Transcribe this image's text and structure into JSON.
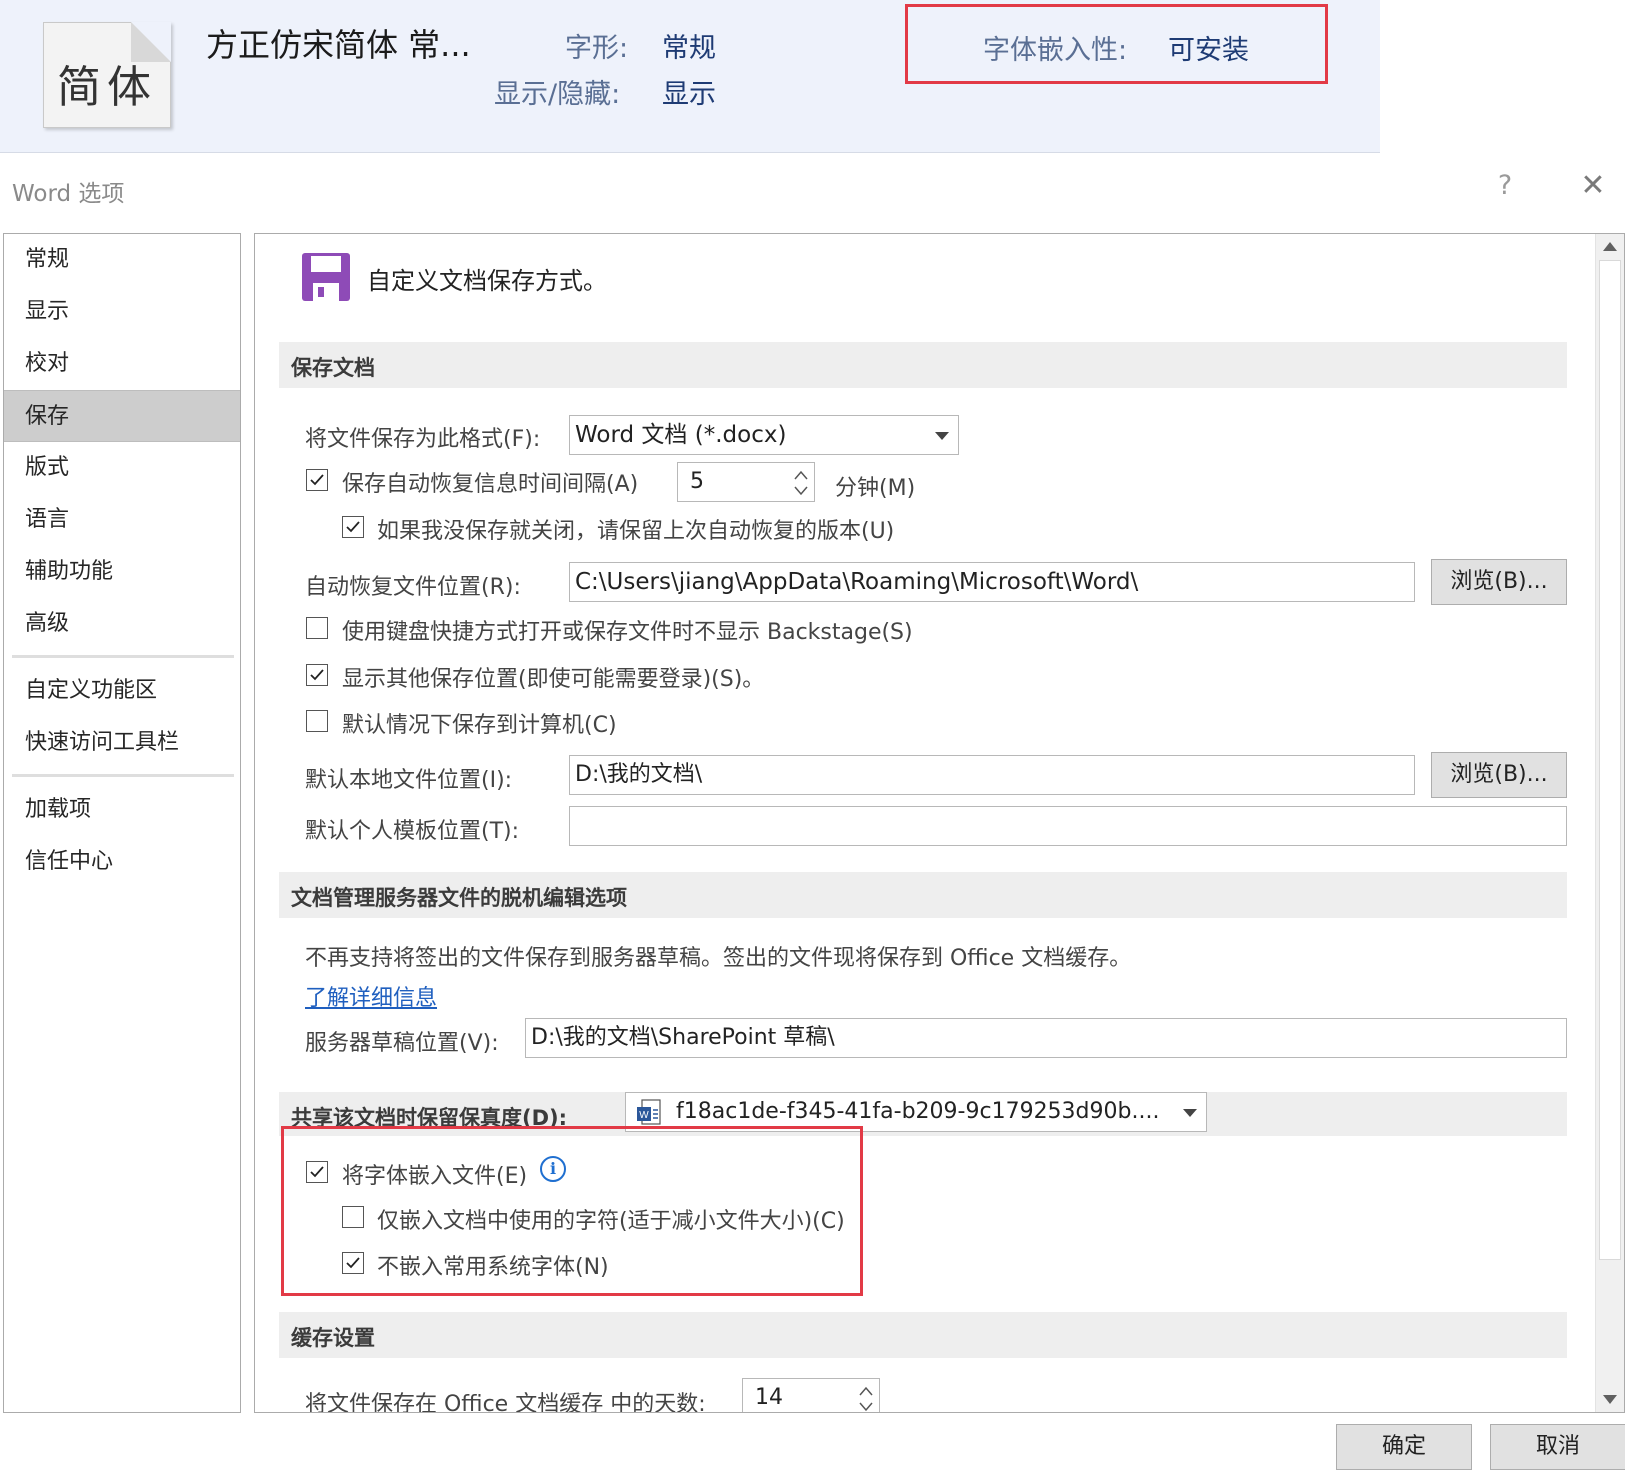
{
  "font_info": {
    "thumbnail": "简体",
    "name": "方正仿宋简体 常...",
    "style_label": "字形:",
    "style_value": "常规",
    "visibility_label": "显示/隐藏:",
    "visibility_value": "显示",
    "embed_label": "字体嵌入性:",
    "embed_value": "可安装"
  },
  "dialog": {
    "title": "Word 选项",
    "help": "?",
    "close": "✕",
    "ok": "确定",
    "cancel": "取消"
  },
  "nav": {
    "items": [
      {
        "label": "常规"
      },
      {
        "label": "显示"
      },
      {
        "label": "校对"
      },
      {
        "label": "保存",
        "selected": true
      },
      {
        "label": "版式"
      },
      {
        "label": "语言"
      },
      {
        "label": "辅助功能"
      },
      {
        "label": "高级"
      },
      {
        "label": "自定义功能区"
      },
      {
        "label": "快速访问工具栏"
      },
      {
        "label": "加载项"
      },
      {
        "label": "信任中心"
      }
    ]
  },
  "page": {
    "icon": "floppy-disk-icon",
    "heading": "自定义文档保存方式。"
  },
  "save_documents": {
    "header": "保存文档",
    "format_label": "将文件保存为此格式(F):",
    "format_value": "Word 文档 (*.docx)",
    "autorecover_label": "保存自动恢复信息时间间隔(A)",
    "autorecover_checked": true,
    "autorecover_minutes": "5",
    "minutes_label": "分钟(M)",
    "keep_last_label": "如果我没保存就关闭，请保留上次自动恢复的版本(U)",
    "keep_last_checked": true,
    "autorecover_location_label": "自动恢复文件位置(R):",
    "autorecover_location_value": "C:\\Users\\jiang\\AppData\\Roaming\\Microsoft\\Word\\",
    "browse_label": "浏览(B)...",
    "no_backstage_label": "使用键盘快捷方式打开或保存文件时不显示 Backstage(S)",
    "no_backstage_checked": false,
    "show_additional_label": "显示其他保存位置(即使可能需要登录)(S)。",
    "show_additional_checked": true,
    "save_to_computer_label": "默认情况下保存到计算机(C)",
    "save_to_computer_checked": false,
    "local_location_label": "默认本地文件位置(I):",
    "local_location_value": "D:\\我的文档\\",
    "browse2_label": "浏览(B)...",
    "template_location_label": "默认个人模板位置(T):",
    "template_location_value": ""
  },
  "offline_editing": {
    "header": "文档管理服务器文件的脱机编辑选项",
    "notice": "不再支持将签出的文件保存到服务器草稿。签出的文件现将保存到 Office 文档缓存。",
    "learn_more": "了解详细信息",
    "drafts_label": "服务器草稿位置(V):",
    "drafts_value": "D:\\我的文档\\SharePoint 草稿\\"
  },
  "fidelity": {
    "header": "共享该文档时保留保真度(D):",
    "document_value": "f18ac1de-f345-41fa-b209-9c179253d90b....",
    "embed_fonts_label": "将字体嵌入文件(E)",
    "embed_fonts_checked": true,
    "info_icon": "i",
    "embed_used_only_label": "仅嵌入文档中使用的字符(适于减小文件大小)(C)",
    "embed_used_only_checked": false,
    "no_common_fonts_label": "不嵌入常用系统字体(N)",
    "no_common_fonts_checked": true
  },
  "cache": {
    "header": "缓存设置",
    "days_label": "将文件保存在 Office 文档缓存 中的天数:",
    "days_value": "14"
  },
  "colors": {
    "highlight_red": "#e23a46",
    "floppy_purple": "#8e4bb7",
    "link_blue": "#1f5fbf",
    "selected_nav": "#cdcdcd"
  }
}
